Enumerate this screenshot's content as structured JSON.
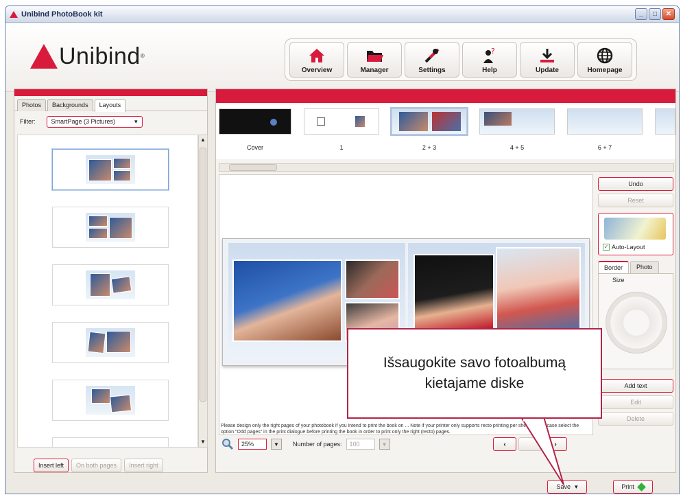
{
  "window": {
    "title": "Unibind PhotoBook kit",
    "min": "_",
    "max": "□",
    "close": "✕"
  },
  "brand": {
    "name": "Unibind",
    "reg": "®"
  },
  "toolbar": [
    {
      "label": "Overview",
      "icon": "home-icon"
    },
    {
      "label": "Manager",
      "icon": "folder-icon"
    },
    {
      "label": "Settings",
      "icon": "tools-icon"
    },
    {
      "label": "Help",
      "icon": "help-icon"
    },
    {
      "label": "Update",
      "icon": "download-icon"
    },
    {
      "label": "Homepage",
      "icon": "globe-icon"
    }
  ],
  "left": {
    "tabs": [
      "Photos",
      "Backgrounds",
      "Layouts"
    ],
    "filter_label": "Filter:",
    "filter_value": "SmartPage (3 Pictures)",
    "buttons": [
      "Insert left",
      "On both pages",
      "Insert right"
    ]
  },
  "filmstrip": {
    "labels": [
      "Cover",
      "1",
      "2 + 3",
      "4 + 5",
      "6 + 7"
    ]
  },
  "right_buttons": {
    "undo": "Undo",
    "reset": "Reset",
    "auto_layout": "Auto-Layout",
    "add_text": "Add text",
    "edit": "Edit",
    "delete": "Delete"
  },
  "subtabs": [
    "Border",
    "Photo"
  ],
  "size_label": "Size",
  "note": "Please design only the right pages of your photobook if you intend to print the book on ... Note if your printer only supports recto printing per sheet. In this case select the option \"Odd pages\" in the print dialogue before printing the book in order to print only the right (recto) pages.",
  "bottom": {
    "zoom": "25%",
    "pages_label": "Number of pages:",
    "pages_value": "100",
    "prev": "‹",
    "next": "›",
    "save": "Save",
    "print": "Print"
  },
  "callout": "Išsaugokite savo fotoalbumą kietajame diske",
  "colors": {
    "accent": "#d81b3c",
    "callout_border": "#b22449"
  }
}
